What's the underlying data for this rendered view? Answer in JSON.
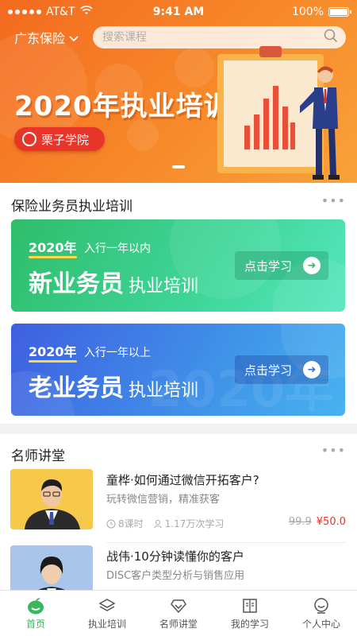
{
  "status": {
    "carrier": "AT&T",
    "time": "9:41 AM",
    "battery": "100%",
    "battery_level": 1.0
  },
  "header": {
    "region": "广东保险",
    "search_placeholder": "搜索课程"
  },
  "banner": {
    "title": "2020年执业培训",
    "brand": "栗子学院"
  },
  "section_training": {
    "title": "保险业务员执业培训",
    "cards": [
      {
        "year": "2020年",
        "subtitle": "入行一年以内",
        "main": "新业务员",
        "suffix": "执业培训",
        "button": "点击学习"
      },
      {
        "year": "2020年",
        "subtitle": "入行一年以上",
        "main": "老业务员",
        "suffix": "执业培训",
        "button": "点击学习"
      }
    ]
  },
  "section_lectures": {
    "title": "名师讲堂",
    "courses": [
      {
        "title": "童桦·如何通过微信开拓客户?",
        "desc": "玩转微信营销，精准获客",
        "lessons": "8课时",
        "views": "1.17万次学习",
        "old_price": "99.9",
        "price": "¥50.0"
      },
      {
        "title": "战伟·10分钟读懂你的客户",
        "desc": "DISC客户类型分析与销售应用"
      }
    ]
  },
  "tabbar": [
    {
      "label": "首页",
      "icon": "home-icon",
      "active": true
    },
    {
      "label": "执业培训",
      "icon": "layers-icon",
      "active": false
    },
    {
      "label": "名师讲堂",
      "icon": "diamond-icon",
      "active": false
    },
    {
      "label": "我的学习",
      "icon": "book-icon",
      "active": false
    },
    {
      "label": "个人中心",
      "icon": "smile-icon",
      "active": false
    }
  ],
  "colors": {
    "accent_green": "#3cb55f",
    "hero_orange": "#f46a1f",
    "price_red": "#f0302a"
  }
}
